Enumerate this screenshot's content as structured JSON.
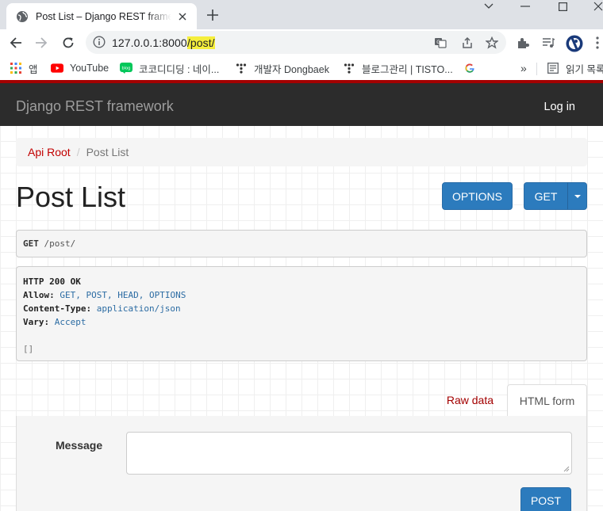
{
  "browser": {
    "tab_title": "Post List – Django REST framework",
    "url_host": "127.0.0.1:8000",
    "url_path": "/post/",
    "accent": "#f5ee3c"
  },
  "bookmarks": {
    "apps": "앱",
    "items": [
      "YouTube",
      "코코디디딩 : 네이...",
      "개발자 Dongbaek",
      "블로그관리 | TISTO..."
    ],
    "overflow": "»",
    "reading_list": "읽기 목록"
  },
  "navbar": {
    "brand": "Django REST framework",
    "login": "Log in"
  },
  "breadcrumb": {
    "root": "Api Root",
    "separator": "/",
    "current": "Post List"
  },
  "page": {
    "title": "Post List",
    "options_label": "OPTIONS",
    "get_label": "GET"
  },
  "request": {
    "method": "GET",
    "path": "/post/"
  },
  "response": {
    "status": "HTTP 200 OK",
    "allow_key": "Allow:",
    "allow_value": "GET, POST, HEAD, OPTIONS",
    "content_type_key": "Content-Type:",
    "content_type_value": "application/json",
    "vary_key": "Vary:",
    "vary_value": "Accept",
    "body": "[]"
  },
  "form": {
    "tab_raw": "Raw data",
    "tab_html": "HTML form",
    "message_label": "Message",
    "message_value": "",
    "post_label": "POST"
  },
  "colors": {
    "drf_red": "#a30000",
    "link_red": "#c20000",
    "button_blue": "#2c7bbd",
    "navbar": "#2c2c2c"
  }
}
